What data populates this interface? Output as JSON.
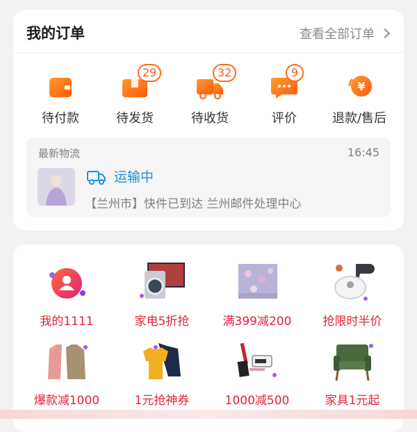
{
  "orders": {
    "title": "我的订单",
    "view_all": "查看全部订单",
    "statuses": [
      {
        "label": "待付款",
        "icon": "wallet-icon"
      },
      {
        "label": "待发货",
        "icon": "package-icon",
        "badge": "29"
      },
      {
        "label": "待收货",
        "icon": "truck-icon",
        "badge": "32"
      },
      {
        "label": "评价",
        "icon": "comment-icon",
        "badge": "9"
      },
      {
        "label": "退款/售后",
        "icon": "refund-yuan-icon"
      }
    ],
    "logistics": {
      "title": "最新物流",
      "time": "16:45",
      "status": "运输中",
      "detail": "【兰州市】快件已到达 兰州邮件处理中心"
    }
  },
  "promos": [
    {
      "label": "我的1111",
      "icon": "user-badge-icon"
    },
    {
      "label": "家电5折抢",
      "icon": "appliance-icon"
    },
    {
      "label": "满399减200",
      "icon": "bedding-icon"
    },
    {
      "label": "抢限时半价",
      "icon": "robot-vacuum-icon"
    },
    {
      "label": "爆款减1000",
      "icon": "coat-icon"
    },
    {
      "label": "1元抢神券",
      "icon": "hoodie-icon"
    },
    {
      "label": "1000减500",
      "icon": "cosmetics-icon"
    },
    {
      "label": "家具1元起",
      "icon": "armchair-icon"
    }
  ],
  "colors": {
    "accent": "#ff6a1a",
    "promo_text": "#e0243a",
    "logistics_status": "#1a8fe0"
  }
}
